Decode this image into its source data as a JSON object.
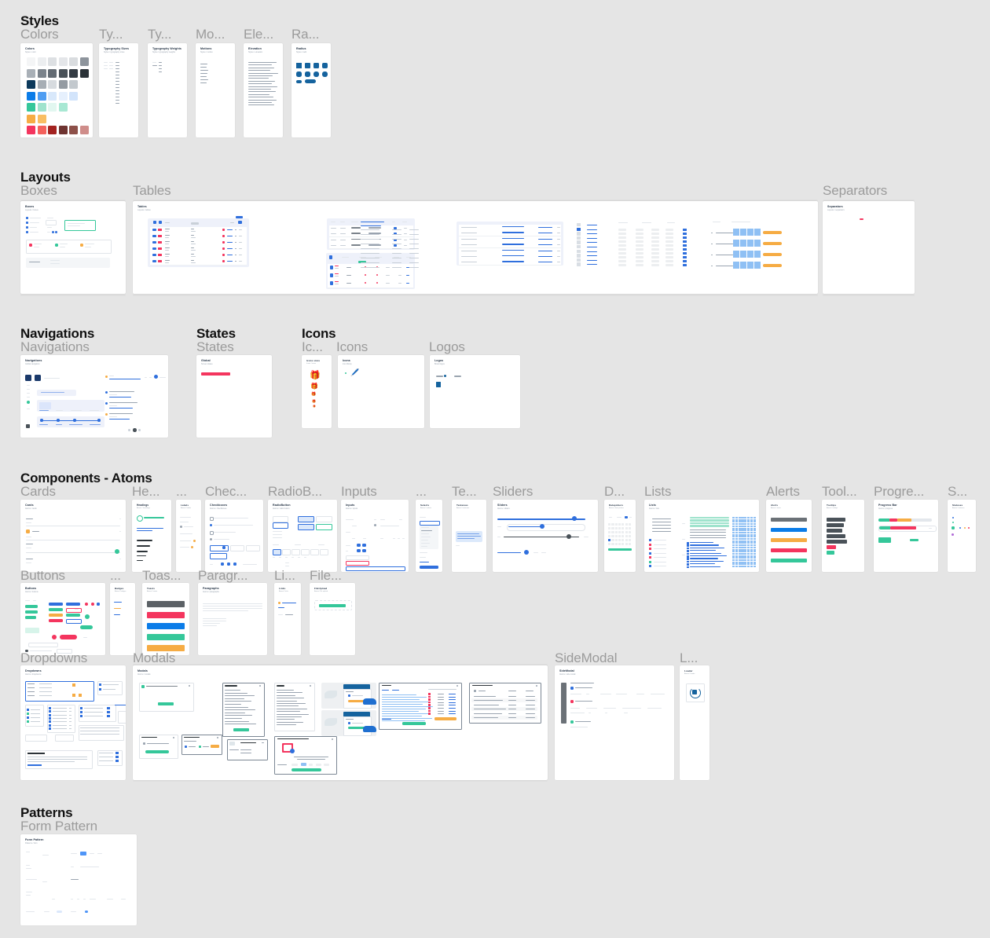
{
  "canvas": {
    "background": "#e5e5e5",
    "group_background": "#dedede",
    "frame_background": "#ffffff",
    "label_color": "#9b9b9b",
    "title_color": "#111111"
  },
  "sections": [
    {
      "id": "styles",
      "title": "Styles",
      "frames": [
        {
          "label": "Colors",
          "name": "Colors",
          "subtitle": "Styles / color"
        },
        {
          "label": "Ty...",
          "name": "Typography Sizes",
          "subtitle": "Styles / typography sizes"
        },
        {
          "label": "Ty...",
          "name": "Typography Weights",
          "subtitle": "Styles / typography weights"
        },
        {
          "label": "Mo...",
          "name": "Motions",
          "subtitle": "Styles / motion"
        },
        {
          "label": "Ele...",
          "name": "Elevation",
          "subtitle": "Styles / elevation"
        },
        {
          "label": "Ra...",
          "name": "Radius",
          "subtitle": "Styles / radii"
        }
      ]
    },
    {
      "id": "layouts",
      "title": "Layouts",
      "frames": [
        {
          "label": "Boxes",
          "name": "Boxes",
          "subtitle": "Layouts / boxes"
        },
        {
          "label": "Tables",
          "name": "Tables",
          "subtitle": "Layouts / tables"
        },
        {
          "label": "Separators",
          "name": "Separators",
          "subtitle": "Layouts / separators"
        }
      ]
    },
    {
      "id": "navigations",
      "title": "Navigations",
      "frames": [
        {
          "label": "Navigations",
          "name": "Navigations",
          "subtitle": "Global navigation"
        }
      ]
    },
    {
      "id": "states",
      "title": "States",
      "frames": [
        {
          "label": "States",
          "name": "Global",
          "subtitle": "Screen states"
        }
      ]
    },
    {
      "id": "icons",
      "title": "Icons",
      "frames": [
        {
          "label": "Ic...",
          "name": "Icons sizes",
          "subtitle": "Icons / sizes"
        },
        {
          "label": "Icons",
          "name": "Icons",
          "subtitle": "Icon library"
        },
        {
          "label": "Logos",
          "name": "Logos",
          "subtitle": "Brand logos"
        }
      ]
    },
    {
      "id": "atoms",
      "title": "Components - Atoms",
      "frames": [
        {
          "label": "Cards",
          "name": "Cards",
          "subtitle": "Atoms / cards"
        },
        {
          "label": "He...",
          "name": "Headings",
          "subtitle": "Atoms / headings"
        },
        {
          "label": "...",
          "name": "Labels",
          "subtitle": "Atoms / labels"
        },
        {
          "label": "Chec...",
          "name": "Checkboxes",
          "subtitle": "Atoms / checkboxes"
        },
        {
          "label": "RadioB...",
          "name": "RadioButton",
          "subtitle": "Atoms / radio button"
        },
        {
          "label": "Inputs",
          "name": "Inputs",
          "subtitle": "Atoms / inputs"
        },
        {
          "label": "...",
          "name": "Selects",
          "subtitle": "Atoms / selects"
        },
        {
          "label": "Te...",
          "name": "Textareas",
          "subtitle": "Atoms / textareas"
        },
        {
          "label": "Sliders",
          "name": "Sliders",
          "subtitle": "Atoms / sliders"
        },
        {
          "label": "D...",
          "name": "Datapickers",
          "subtitle": "Atoms / date pickers"
        },
        {
          "label": "Lists",
          "name": "Lists",
          "subtitle": "Atoms / lists"
        },
        {
          "label": "Alerts",
          "name": "Alerts",
          "subtitle": "Atoms / alerts"
        },
        {
          "label": "Tool...",
          "name": "Tooltips",
          "subtitle": "Atoms / tooltips"
        },
        {
          "label": "Progre...",
          "name": "Progress Bar",
          "subtitle": "Atoms / progress"
        },
        {
          "label": "S...",
          "name": "Statuses",
          "subtitle": "Atoms / statuses"
        },
        {
          "label": "Buttons",
          "name": "Buttons",
          "subtitle": "Atoms / buttons"
        },
        {
          "label": "...",
          "name": "Badges",
          "subtitle": "Atoms / badges"
        },
        {
          "label": "Toas...",
          "name": "Toasts",
          "subtitle": "Atoms / toasts"
        },
        {
          "label": "Paragr...",
          "name": "Paragraphs",
          "subtitle": "Atoms / paragraphs"
        },
        {
          "label": "Li...",
          "name": "Links",
          "subtitle": "Atoms / links"
        },
        {
          "label": "File...",
          "name": "FileUpload",
          "subtitle": "Atoms / file upload"
        },
        {
          "label": "Dropdowns",
          "name": "Dropdowns",
          "subtitle": "Atoms / dropdowns"
        },
        {
          "label": "Modals",
          "name": "Modals",
          "subtitle": "Atoms / modals"
        },
        {
          "label": "SideModal",
          "name": "SideModal",
          "subtitle": "Atoms / side modal"
        },
        {
          "label": "L...",
          "name": "Loader",
          "subtitle": "Atoms / loader"
        }
      ]
    },
    {
      "id": "patterns",
      "title": "Patterns",
      "frames": [
        {
          "label": "Form Pattern",
          "name": "Form Pattern",
          "subtitle": "Patterns / form"
        }
      ]
    }
  ],
  "palette": {
    "rows": [
      [
        "#f4f5f6",
        "#eceef0",
        "#dde0e3",
        "#e4e6e9",
        "#d9dcdf",
        "#8d949c"
      ],
      [
        "#a9b0b7",
        "#7b838b",
        "#636b73",
        "#4a5259",
        "#343c44",
        "#2b3238"
      ],
      [
        "#0d3a5c",
        "#a7aeb5",
        "#d7dbdf",
        "#949ba2",
        "#c3c9ce"
      ],
      [
        "#0b7ce8",
        "#4e9df2",
        "#d8e8fb",
        "#e6f0fd",
        "#d2e4fb"
      ],
      [
        "#35c79a",
        "#9fe3cd",
        "#e2f7f0",
        "#a8e8d3"
      ],
      [
        "#f6ac44",
        "#f9be63"
      ],
      [
        "#f4355e",
        "#f4615c",
        "#a32220",
        "#6e3330",
        "#8d5049",
        "#cf8d8a"
      ]
    ]
  },
  "radius_swatches": {
    "fill": "#15639e",
    "count_row1": 4,
    "count_row2": 4
  },
  "alerts_colors": [
    "#6b7177",
    "#0b7ce8",
    "#f6ac44",
    "#f4355e",
    "#35c79a"
  ],
  "toasts_colors": [
    "#5c6166",
    "#f4355e",
    "#0b7ce8",
    "#35c79a",
    "#f6ac44"
  ],
  "tooltip_colors": [
    "#4a5259",
    "#4a5259",
    "#4a5259",
    "#4a5259",
    "#4a5259",
    "#f4355e",
    "#35c79a"
  ],
  "progress_colors": {
    "teal": "#35c79a",
    "pink": "#f4355e",
    "orange": "#f6ac44",
    "track": "#e3e7ec"
  },
  "separators_accent": "#f4355e",
  "states_accent": "#f4355e",
  "loader_accent": "#15639e"
}
